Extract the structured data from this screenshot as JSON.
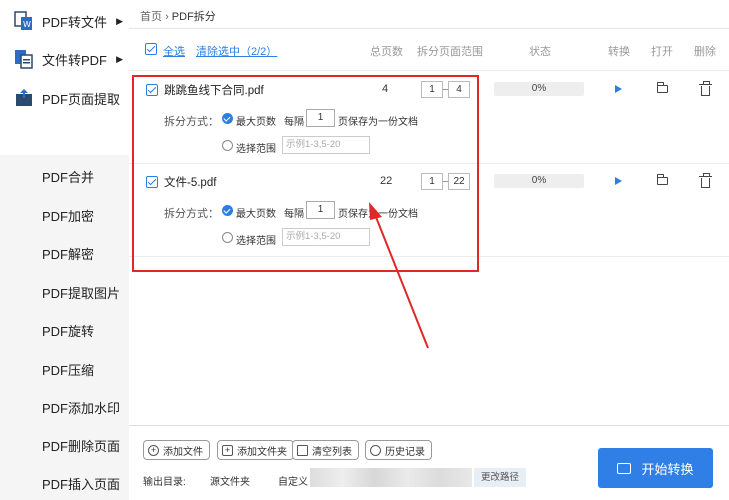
{
  "sidebar": {
    "top_items": [
      {
        "label": "PDF转文件",
        "icon": "pdf-to-file-icon",
        "has_arrow": true
      },
      {
        "label": "文件转PDF",
        "icon": "file-to-pdf-icon",
        "has_arrow": true
      },
      {
        "label": "PDF页面提取",
        "icon": "page-extract-icon",
        "has_arrow": false
      }
    ],
    "arrow_glyph": "▶",
    "sub_items": [
      "PDF合并",
      "PDF加密",
      "PDF解密",
      "PDF提取图片",
      "PDF旋转",
      "PDF压缩",
      "PDF添加水印",
      "PDF删除页面",
      "PDF插入页面"
    ]
  },
  "breadcrumb": {
    "home": "首页",
    "sep": "›",
    "current": "PDF拆分"
  },
  "toolbar": {
    "select_all": "全选",
    "clear_selection": "清除选中（2/2）",
    "columns": {
      "total_pages": "总页数",
      "split_range": "拆分页面范围",
      "status": "状态",
      "convert": "转换",
      "open": "打开",
      "delete": "删除"
    }
  },
  "files": [
    {
      "name": "跳跳鱼线下合同.pdf",
      "pages": "4",
      "range_from": "1",
      "range_to": "4",
      "status": "0%",
      "split_label": "拆分方式：",
      "max_pages_label": "最大页数",
      "every_label": "每隔",
      "every_value": "1",
      "save_suffix": "页保存为一份文档",
      "range_label": "选择范围",
      "range_placeholder": "示例1-3,5-20"
    },
    {
      "name": "文件-5.pdf",
      "pages": "22",
      "range_from": "1",
      "range_to": "22",
      "status": "0%",
      "split_label": "拆分方式：",
      "max_pages_label": "最大页数",
      "every_label": "每隔",
      "every_value": "1",
      "save_suffix": "页保存为一份文档",
      "range_label": "选择范围",
      "range_placeholder": "示例1-3,5-20"
    }
  ],
  "bottom": {
    "add_file": "添加文件",
    "add_folder": "添加文件夹",
    "clear_list": "清空列表",
    "history": "历史记录",
    "output_label": "输出目录:",
    "source_folder": "源文件夹",
    "custom": "自定义",
    "change_path": "更改路径",
    "start": "开始转换"
  },
  "colors": {
    "accent": "#2f7fe6",
    "highlight": "#e02828"
  }
}
